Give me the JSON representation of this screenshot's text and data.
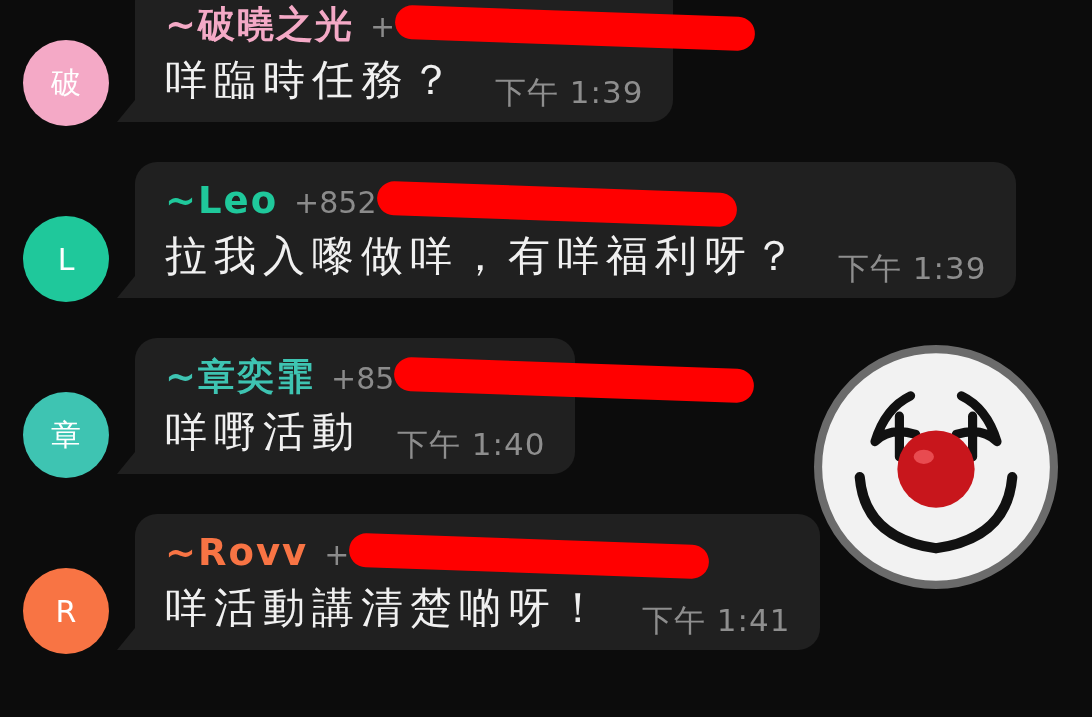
{
  "messages": [
    {
      "avatar": "破",
      "color": "#f4a9c6",
      "sender": "~破曉之光",
      "phone": "+",
      "phone_redacted": true,
      "text": "咩臨時任務？",
      "time": "下午 1:39"
    },
    {
      "avatar": "L",
      "color": "#1fc89b",
      "sender": "~Leo",
      "phone": "+852",
      "phone_redacted": true,
      "text": "拉我入嚟做咩，有咩福利呀？",
      "time": "下午 1:39"
    },
    {
      "avatar": "章",
      "color": "#3ec4b2",
      "sender": "~章奕霏",
      "phone": "+85",
      "phone_redacted": true,
      "text": "咩嘢活動",
      "time": "下午 1:40"
    },
    {
      "avatar": "R",
      "color": "#f87444",
      "sender": "~Rovv",
      "phone": "+",
      "phone_redacted": true,
      "text": "咩活動講清楚啲呀！",
      "time": "下午 1:41"
    }
  ]
}
